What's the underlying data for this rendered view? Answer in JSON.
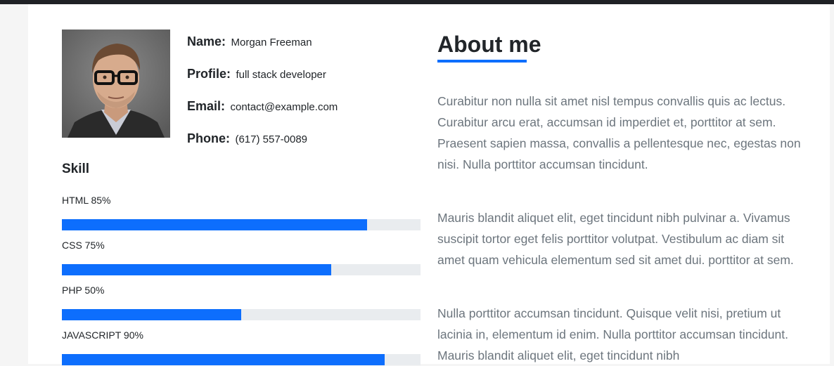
{
  "profile": {
    "name_label": "Name:",
    "name_value": "Morgan Freeman",
    "profile_label": "Profile:",
    "profile_value": "full stack developer",
    "email_label": "Email:",
    "email_value": "contact@example.com",
    "phone_label": "Phone:",
    "phone_value": "(617) 557-0089"
  },
  "skills": {
    "title": "Skill",
    "items": [
      {
        "label": "HTML 85%",
        "percent": 85
      },
      {
        "label": "CSS 75%",
        "percent": 75
      },
      {
        "label": "PHP 50%",
        "percent": 50
      },
      {
        "label": "JAVASCRIPT 90%",
        "percent": 90
      }
    ]
  },
  "about": {
    "title": "About me",
    "paragraphs": [
      "Curabitur non nulla sit amet nisl tempus convallis quis ac lectus. Curabitur arcu erat, accumsan id imperdiet et, porttitor at sem. Praesent sapien massa, convallis a pellentesque nec, egestas non nisi. Nulla porttitor accumsan tincidunt.",
      "Mauris blandit aliquet elit, eget tincidunt nibh pulvinar a. Vivamus suscipit tortor eget felis porttitor volutpat. Vestibulum ac diam sit amet quam vehicula elementum sed sit amet dui. porttitor at sem.",
      "Nulla porttitor accumsan tincidunt. Quisque velit nisi, pretium ut lacinia in, elementum id enim. Nulla porttitor accumsan tincidunt. Mauris blandit aliquet elit, eget tincidunt nibh"
    ]
  },
  "colors": {
    "accent": "#0d6efd",
    "progress_track": "#e9ecef",
    "topbar": "#1f2125"
  }
}
